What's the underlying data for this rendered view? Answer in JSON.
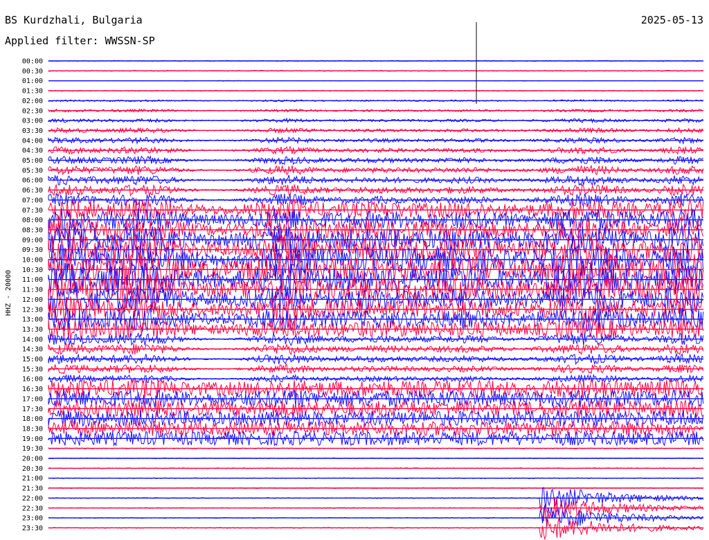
{
  "header": {
    "station": "BS Kurdzhali, Bulgaria",
    "date": "2025-05-13",
    "filter": "Applied filter: WWSSN-SP"
  },
  "chart_data": {
    "type": "line",
    "subtype": "helicorder",
    "ylabel": "HHZ - 20000",
    "row_labels": [
      "00:00",
      "00:30",
      "01:00",
      "01:30",
      "02:00",
      "02:30",
      "03:00",
      "03:30",
      "04:00",
      "04:30",
      "05:00",
      "05:30",
      "06:00",
      "06:30",
      "07:00",
      "07:30",
      "08:00",
      "08:30",
      "09:00",
      "09:30",
      "10:00",
      "10:30",
      "11:00",
      "11:30",
      "12:00",
      "12:30",
      "13:00",
      "13:30",
      "14:00",
      "14:30",
      "15:00",
      "15:30",
      "16:00",
      "16:30",
      "17:00",
      "17:30",
      "18:00",
      "18:30",
      "19:00",
      "19:30",
      "20:00",
      "20:30",
      "21:00",
      "21:30",
      "22:00",
      "22:30",
      "23:00",
      "23:30"
    ],
    "colors": [
      "#1010ff",
      "#ff0040"
    ],
    "grid": false
  }
}
